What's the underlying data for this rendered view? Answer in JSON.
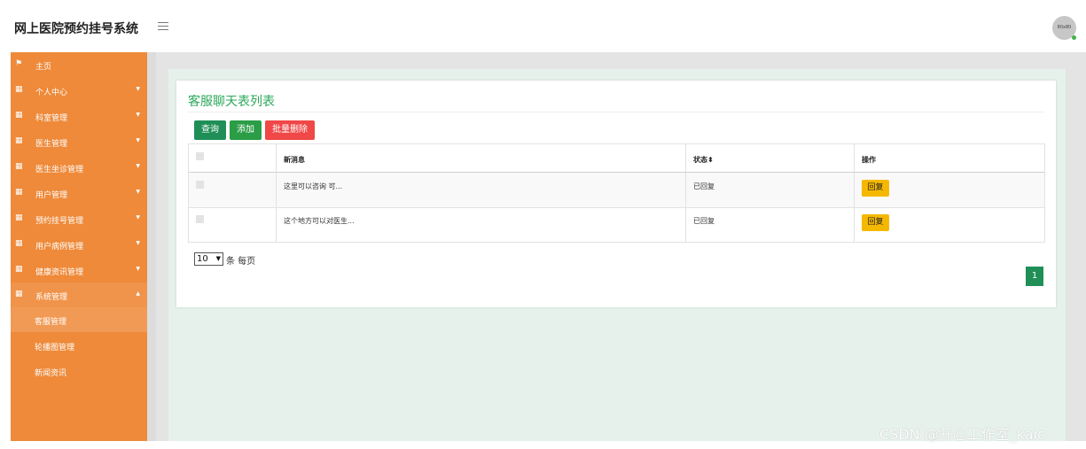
{
  "app": {
    "title": "网上医院预约挂号系统",
    "avatar_text": "80x80"
  },
  "sidebar": {
    "items": [
      {
        "label": "主页",
        "icon": "flag-icon",
        "has_caret": false
      },
      {
        "label": "个人中心",
        "icon": "grid-icon",
        "has_caret": true
      },
      {
        "label": "科室管理",
        "icon": "grid-icon",
        "has_caret": true
      },
      {
        "label": "医生管理",
        "icon": "grid-icon",
        "has_caret": true
      },
      {
        "label": "医生坐诊管理",
        "icon": "grid-icon",
        "has_caret": true
      },
      {
        "label": "用户管理",
        "icon": "grid-icon",
        "has_caret": true
      },
      {
        "label": "预约挂号管理",
        "icon": "grid-icon",
        "has_caret": true
      },
      {
        "label": "用户病例管理",
        "icon": "grid-icon",
        "has_caret": true
      },
      {
        "label": "健康资讯管理",
        "icon": "grid-icon",
        "has_caret": true
      },
      {
        "label": "系统管理",
        "icon": "grid-icon",
        "has_caret": true
      }
    ],
    "sub_items": [
      {
        "label": "客服管理",
        "active": true
      },
      {
        "label": "轮播图管理",
        "active": false
      },
      {
        "label": "新闻资讯",
        "active": false
      }
    ]
  },
  "main": {
    "card_title": "客服聊天表列表",
    "buttons": {
      "search": "查询",
      "add": "添加",
      "batch_delete": "批量删除"
    },
    "table": {
      "columns": [
        "新消息",
        "状态",
        "操作"
      ],
      "sort_icon": "⬍",
      "rows": [
        {
          "message": "这里可以咨询 可...",
          "status": "已回复",
          "action": "回复"
        },
        {
          "message": "这个地方可以对医生...",
          "status": "已回复",
          "action": "回复"
        }
      ]
    },
    "pagination": {
      "page_size": "10",
      "per_page_label": "条 每页",
      "current_page": "1"
    }
  },
  "watermark": "CSDN @开心工作室_kaic",
  "colors": {
    "sidebar": "#ee8a3a",
    "primary_green": "#1f8f57",
    "add_green": "#2a9d46",
    "danger": "#f04747",
    "warning": "#f5b800",
    "title_green": "#2aa85a"
  }
}
